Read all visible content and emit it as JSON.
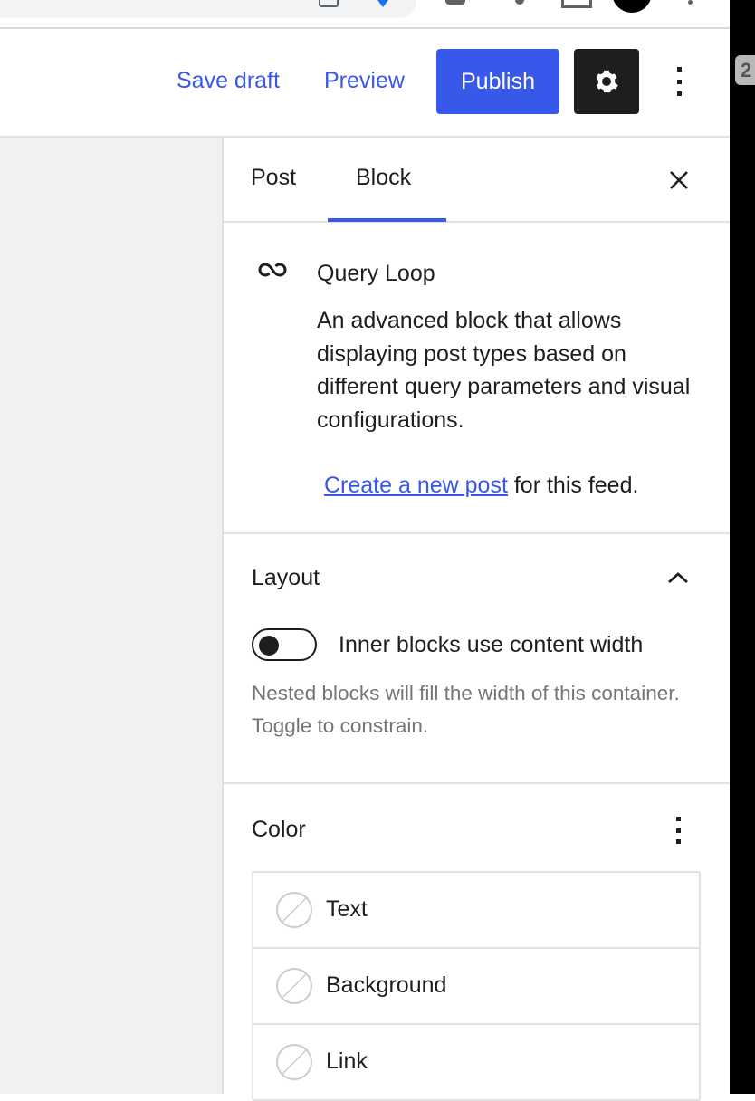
{
  "header": {
    "save_draft": "Save draft",
    "preview": "Preview",
    "publish": "Publish",
    "accent_color": "#3858e9"
  },
  "side_badge": "2",
  "sidebar": {
    "tabs": [
      {
        "label": "Post",
        "active": false
      },
      {
        "label": "Block",
        "active": true
      }
    ],
    "block_card": {
      "icon": "loop-icon",
      "title": "Query Loop",
      "description": "An advanced block that allows displaying post types based on different query parameters and visual configurations.",
      "create_link": "Create a new post",
      "create_suffix": " for this feed."
    },
    "layout": {
      "title": "Layout",
      "toggle_label": "Inner blocks use content width",
      "toggle_on": false,
      "help": "Nested blocks will fill the width of this container. Toggle to constrain."
    },
    "color": {
      "title": "Color",
      "items": [
        {
          "label": "Text"
        },
        {
          "label": "Background"
        },
        {
          "label": "Link"
        }
      ]
    }
  }
}
